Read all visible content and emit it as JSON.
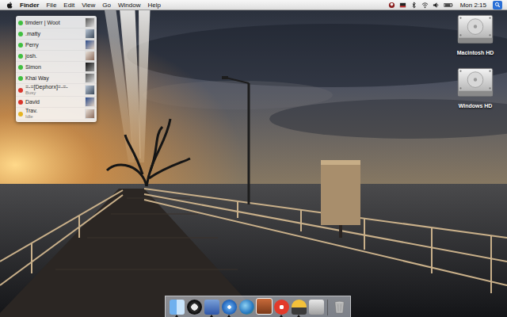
{
  "menu_bar": {
    "app_name": "Finder",
    "menus": [
      "File",
      "Edit",
      "View",
      "Go",
      "Window",
      "Help"
    ],
    "clock": "Mon 2:15"
  },
  "buddy_list": [
    {
      "name": "timderr | Woot",
      "status_text": "",
      "color": "#3fbf3f"
    },
    {
      "name": ".matty",
      "status_text": "",
      "color": "#3fbf3f"
    },
    {
      "name": "Perry",
      "status_text": "",
      "color": "#3fbf3f"
    },
    {
      "name": "josh.",
      "status_text": "",
      "color": "#3fbf3f"
    },
    {
      "name": "Simon",
      "status_text": "",
      "color": "#3fbf3f"
    },
    {
      "name": "Khai Way",
      "status_text": "",
      "color": "#3fbf3f"
    },
    {
      "name": "=-=[Dephorx]=-=-",
      "status_text": "Busy",
      "color": "#d9342b"
    },
    {
      "name": "David",
      "status_text": "",
      "color": "#d9342b"
    },
    {
      "name": "Trav.",
      "status_text": "Idle",
      "color": "#e6b422"
    }
  ],
  "desktop_icons": [
    {
      "label": "Macintosh HD"
    },
    {
      "label": "Windows HD"
    }
  ],
  "dock": {
    "items": [
      {
        "running": true
      },
      {
        "running": false
      },
      {
        "running": true
      },
      {
        "running": true
      },
      {
        "running": false
      },
      {
        "running": false
      },
      {
        "running": true
      },
      {
        "running": true
      },
      {
        "running": false
      }
    ],
    "trash": {
      "running": false
    }
  }
}
